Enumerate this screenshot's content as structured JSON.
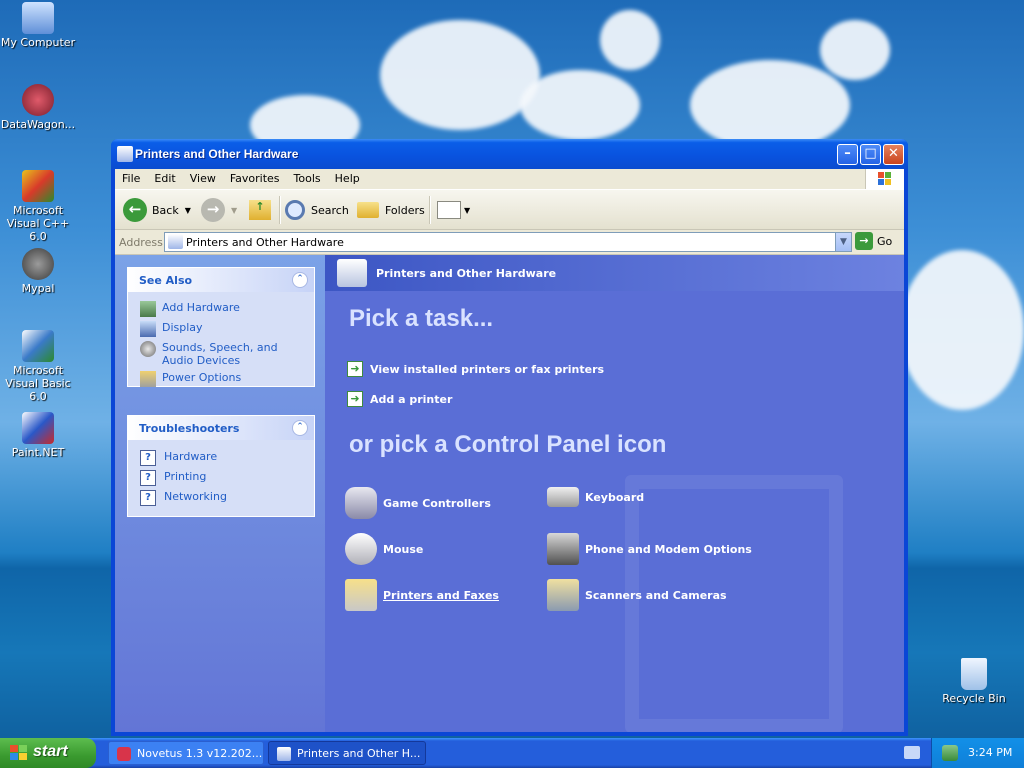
{
  "desktop": {
    "icons": [
      {
        "label": "My Computer",
        "icon": "my-computer-icon"
      },
      {
        "label": "DataWagon...",
        "icon": "shortcut-icon"
      },
      {
        "label": "Microsoft Visual C++ 6.0",
        "icon": "visual-cpp-icon"
      },
      {
        "label": "Mypal",
        "icon": "mypal-icon"
      },
      {
        "label": "Microsoft Visual Basic 6.0",
        "icon": "visual-basic-icon"
      },
      {
        "label": "Paint.NET",
        "icon": "paintnet-icon"
      },
      {
        "label": "Recycle Bin",
        "icon": "recycle-bin-icon"
      }
    ]
  },
  "window": {
    "title": "Printers and Other Hardware",
    "menu": [
      "File",
      "Edit",
      "View",
      "Favorites",
      "Tools",
      "Help"
    ],
    "toolbar": {
      "back": "Back",
      "search": "Search",
      "folders": "Folders"
    },
    "address": {
      "label": "Address",
      "value": "Printers and Other Hardware",
      "go": "Go"
    }
  },
  "sidebar": {
    "see_also": {
      "title": "See Also",
      "items": [
        "Add Hardware",
        "Display",
        "Sounds, Speech, and Audio Devices",
        "Power Options"
      ]
    },
    "troubleshooters": {
      "title": "Troubleshooters",
      "items": [
        "Hardware",
        "Printing",
        "Networking"
      ]
    }
  },
  "main": {
    "header": "Printers and Other Hardware",
    "pick_task": "Pick a task...",
    "tasks": [
      "View installed printers or fax printers",
      "Add a printer"
    ],
    "pick_icon": "or pick a Control Panel icon",
    "icons": [
      "Game Controllers",
      "Keyboard",
      "Mouse",
      "Phone and Modem Options",
      "Printers and Faxes",
      "Scanners and Cameras"
    ]
  },
  "taskbar": {
    "start": "start",
    "buttons": [
      "Novetus 1.3 v12.202...",
      "Printers and Other H..."
    ],
    "clock": "3:24 PM"
  },
  "colors": {
    "title_bar": "#0a5ee8",
    "start_button": "#3a9a2f",
    "link": "#215dc6"
  }
}
